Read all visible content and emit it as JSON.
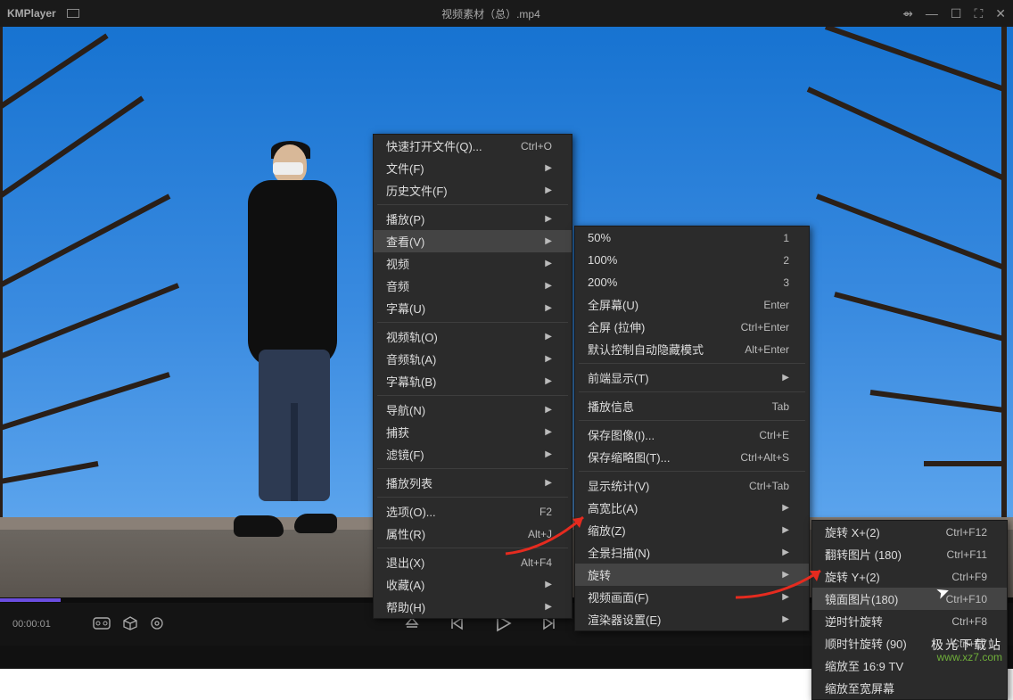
{
  "titlebar": {
    "appName": "KMPlayer",
    "title": "视频素材（总）.mp4"
  },
  "time": "00:00:01",
  "menu1": {
    "items": [
      {
        "label": "快速打开文件(Q)...",
        "shortcut": "Ctrl+O"
      },
      {
        "label": "文件(F)",
        "sub": true
      },
      {
        "label": "历史文件(F)",
        "sub": true
      },
      {
        "sep": true
      },
      {
        "label": "播放(P)",
        "sub": true
      },
      {
        "label": "查看(V)",
        "sub": true,
        "hover": true
      },
      {
        "label": "视频",
        "sub": true
      },
      {
        "label": "音频",
        "sub": true
      },
      {
        "label": "字幕(U)",
        "sub": true
      },
      {
        "sep": true
      },
      {
        "label": "视频轨(O)",
        "sub": true
      },
      {
        "label": "音频轨(A)",
        "sub": true
      },
      {
        "label": "字幕轨(B)",
        "sub": true
      },
      {
        "sep": true
      },
      {
        "label": "导航(N)",
        "sub": true
      },
      {
        "label": "捕获",
        "sub": true
      },
      {
        "label": "滤镜(F)",
        "sub": true
      },
      {
        "sep": true
      },
      {
        "label": "播放列表",
        "sub": true
      },
      {
        "sep": true
      },
      {
        "label": "选项(O)...",
        "shortcut": "F2"
      },
      {
        "label": "属性(R)",
        "shortcut": "Alt+J"
      },
      {
        "sep": true
      },
      {
        "label": "退出(X)",
        "shortcut": "Alt+F4"
      },
      {
        "label": "收藏(A)",
        "sub": true
      },
      {
        "label": "帮助(H)",
        "sub": true
      }
    ]
  },
  "menu2": {
    "items": [
      {
        "label": "50%",
        "shortcut": "1"
      },
      {
        "label": "100%",
        "shortcut": "2"
      },
      {
        "label": "200%",
        "shortcut": "3"
      },
      {
        "label": "全屏幕(U)",
        "shortcut": "Enter"
      },
      {
        "label": "全屏 (拉伸)",
        "shortcut": "Ctrl+Enter"
      },
      {
        "label": "默认控制自动隐藏模式",
        "shortcut": "Alt+Enter"
      },
      {
        "sep": true
      },
      {
        "label": "前端显示(T)",
        "sub": true
      },
      {
        "sep": true
      },
      {
        "label": "播放信息",
        "shortcut": "Tab"
      },
      {
        "sep": true
      },
      {
        "label": "保存图像(I)...",
        "shortcut": "Ctrl+E"
      },
      {
        "label": "保存缩略图(T)...",
        "shortcut": "Ctrl+Alt+S"
      },
      {
        "sep": true
      },
      {
        "label": "显示统计(V)",
        "shortcut": "Ctrl+Tab"
      },
      {
        "label": "高宽比(A)",
        "sub": true
      },
      {
        "label": "缩放(Z)",
        "sub": true
      },
      {
        "label": "全景扫描(N)",
        "sub": true
      },
      {
        "label": "旋转",
        "sub": true,
        "hover": true
      },
      {
        "label": "视频画面(F)",
        "sub": true
      },
      {
        "label": "渲染器设置(E)",
        "sub": true
      }
    ]
  },
  "menu3": {
    "items": [
      {
        "label": "旋转 X+(2)",
        "shortcut": "Ctrl+F12"
      },
      {
        "label": "翻转图片  (180)",
        "shortcut": "Ctrl+F11"
      },
      {
        "label": "旋转 Y+(2)",
        "shortcut": "Ctrl+F9"
      },
      {
        "label": "镜面图片(180)",
        "shortcut": "Ctrl+F10",
        "hover": true
      },
      {
        "label": "逆时针旋转",
        "shortcut": "Ctrl+F8"
      },
      {
        "label": "顺时针旋转  (90)",
        "shortcut": "Ctrl+F7"
      },
      {
        "label": "缩放至 16:9 TV"
      },
      {
        "label": "缩放至宽屏幕"
      }
    ]
  },
  "watermark": {
    "zh": "极光下载站",
    "url": "www.xz7.com"
  }
}
